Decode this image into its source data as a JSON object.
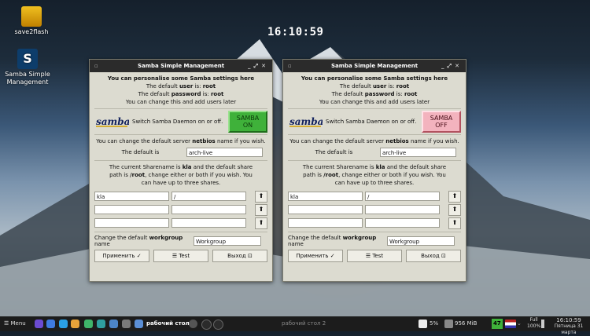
{
  "desktop": {
    "clock": "16:10:59",
    "icons": [
      {
        "label": "save2flash"
      },
      {
        "label_line1": "Samba Simple",
        "label_line2": "Management"
      }
    ]
  },
  "window": {
    "title": "Samba Simple Management",
    "heading": "You can personalise some Samba settings here",
    "user_prefix": "The default ",
    "user_word": "user",
    "user_mid": " is: ",
    "user_value": "root",
    "pw_prefix": "The default ",
    "pw_word": "password",
    "pw_mid": " is: ",
    "pw_value": "root",
    "change_note": "You can change this and add users later",
    "samba_logo": "samba",
    "switch_text": "Switch Samba Daemon on or off.",
    "netbios_pre": "You can change the default server ",
    "netbios_word": "netbios",
    "netbios_post": " name if you wish.",
    "default_is": "The default is",
    "netbios_value": "arch-live",
    "share_p1": "The current Sharename is ",
    "share_name": "kla",
    "share_p2": " and the default share",
    "share_p3": "path is ",
    "share_path": "/root",
    "share_p4": ", change either or both if you wish. You",
    "share_p5": "can have up to three shares.",
    "shares": [
      {
        "name": "kla",
        "path": "/"
      },
      {
        "name": "",
        "path": ""
      },
      {
        "name": "",
        "path": ""
      }
    ],
    "up_glyph": "⬆",
    "wg_pre": "Change the default ",
    "wg_word": "workgroup",
    "wg_post": " name",
    "workgroup_value": "Workgroup",
    "btn_apply": "Применить ✓",
    "btn_test": "☰ Test",
    "btn_exit": "Выход ⊡"
  },
  "samba_states": {
    "left": "SAMBA ON",
    "left_l1": "SAMBA",
    "left_l2": "ON",
    "right_l1": "SAMBA",
    "right_l2": "OFF"
  },
  "taskbar": {
    "menu": "Menu",
    "desk1": "рабочий стол 1",
    "desk2": "рабочий стол 2",
    "cpu": "5%",
    "mem": "956 MiB",
    "num": "47",
    "full": "Full",
    "full_pct": "100%",
    "time": "16:10:59",
    "date": "Пятница 31 марта"
  },
  "colors": {
    "on": "#3fb13a",
    "off": "#f3b3be",
    "panel": "#dcdbd0"
  }
}
